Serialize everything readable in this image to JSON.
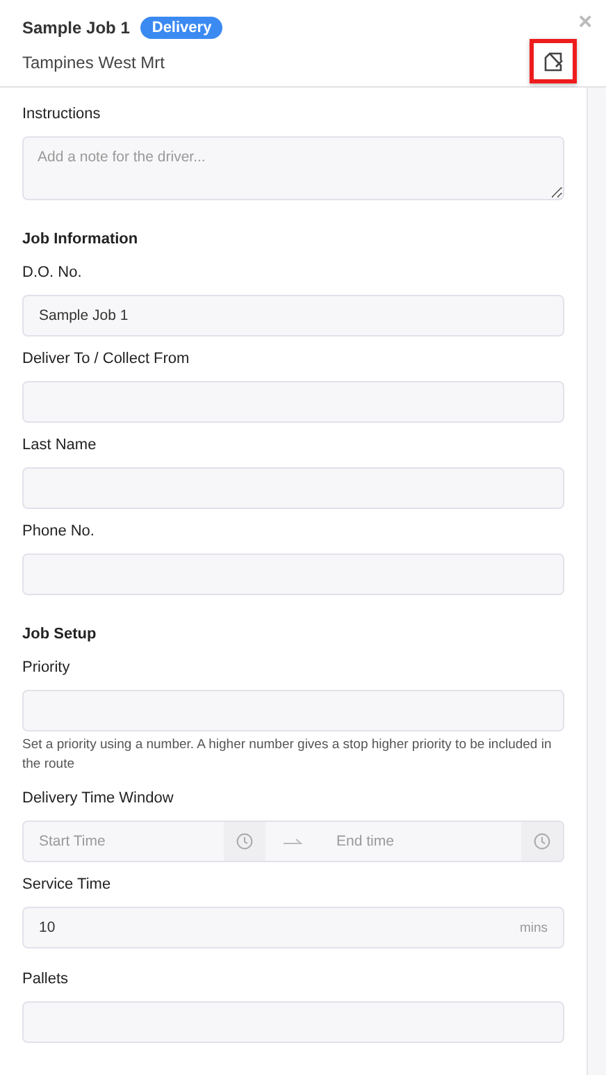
{
  "header": {
    "title": "Sample Job 1",
    "badge": "Delivery",
    "subtitle": "Tampines West Mrt",
    "close": "×"
  },
  "instructions": {
    "label": "Instructions",
    "placeholder": "Add a note for the driver..."
  },
  "sections": [
    {
      "heading": "Job Information",
      "fields": [
        {
          "kind": "text",
          "label": "D.O. No.",
          "value": "Sample Job 1"
        },
        {
          "kind": "text",
          "label": "Deliver To / Collect From"
        },
        {
          "kind": "text",
          "label": "Last Name"
        },
        {
          "kind": "text",
          "label": "Phone No."
        }
      ]
    },
    {
      "heading": "Job Setup",
      "fields": [
        {
          "kind": "text",
          "label": "Priority",
          "hint": "Set a priority using a number. A higher number gives a stop higher priority to be included in the route"
        },
        {
          "kind": "time-range",
          "label": "Delivery Time Window",
          "start_placeholder": "Start Time",
          "end_placeholder": "End time"
        },
        {
          "kind": "unit",
          "label": "Service Time",
          "value": "10",
          "unit": "mins"
        },
        {
          "kind": "text",
          "label": "Pallets"
        }
      ]
    }
  ]
}
